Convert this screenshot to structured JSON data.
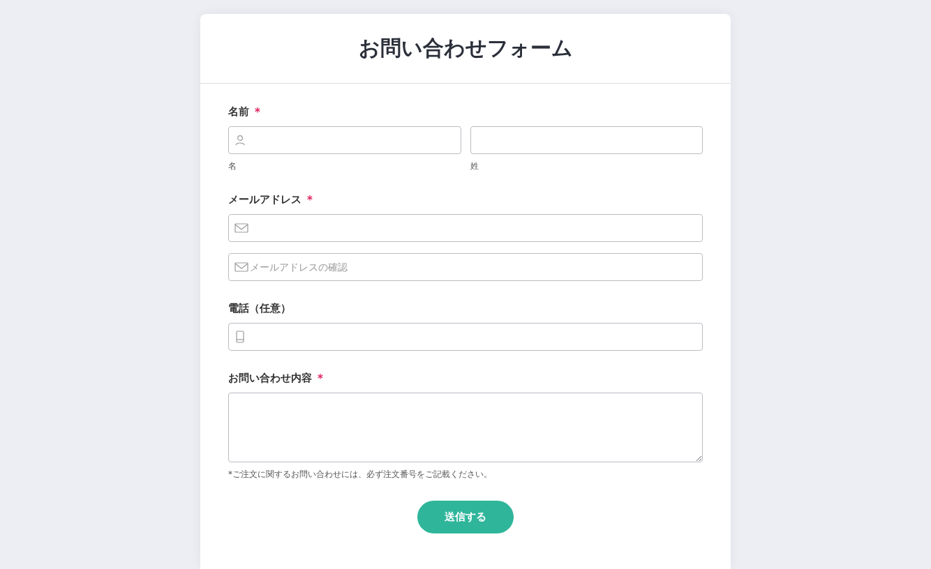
{
  "form": {
    "title": "お問い合わせフォーム",
    "sections": [
      {
        "kind": "row",
        "label": "名前",
        "required_mark": "*",
        "inputs": [
          {
            "kind": "person",
            "caption": "名"
          },
          {
            "kind": "plain",
            "caption": "姓"
          }
        ]
      },
      {
        "kind": "stack",
        "label": "メールアドレス",
        "required_mark": "*",
        "inputs": [
          {
            "kind": "mail"
          },
          {
            "kind": "mail",
            "placeholder": "メールアドレスの確認"
          }
        ]
      },
      {
        "kind": "stack",
        "label": "電話（任意）",
        "inputs": [
          {
            "kind": "phone"
          }
        ]
      },
      {
        "kind": "textarea",
        "label": "お問い合わせ内容",
        "required_mark": "*",
        "note": "*ご注文に関するお問い合わせには、必ず注文番号をご記載ください。"
      }
    ],
    "submit": "送信する"
  }
}
